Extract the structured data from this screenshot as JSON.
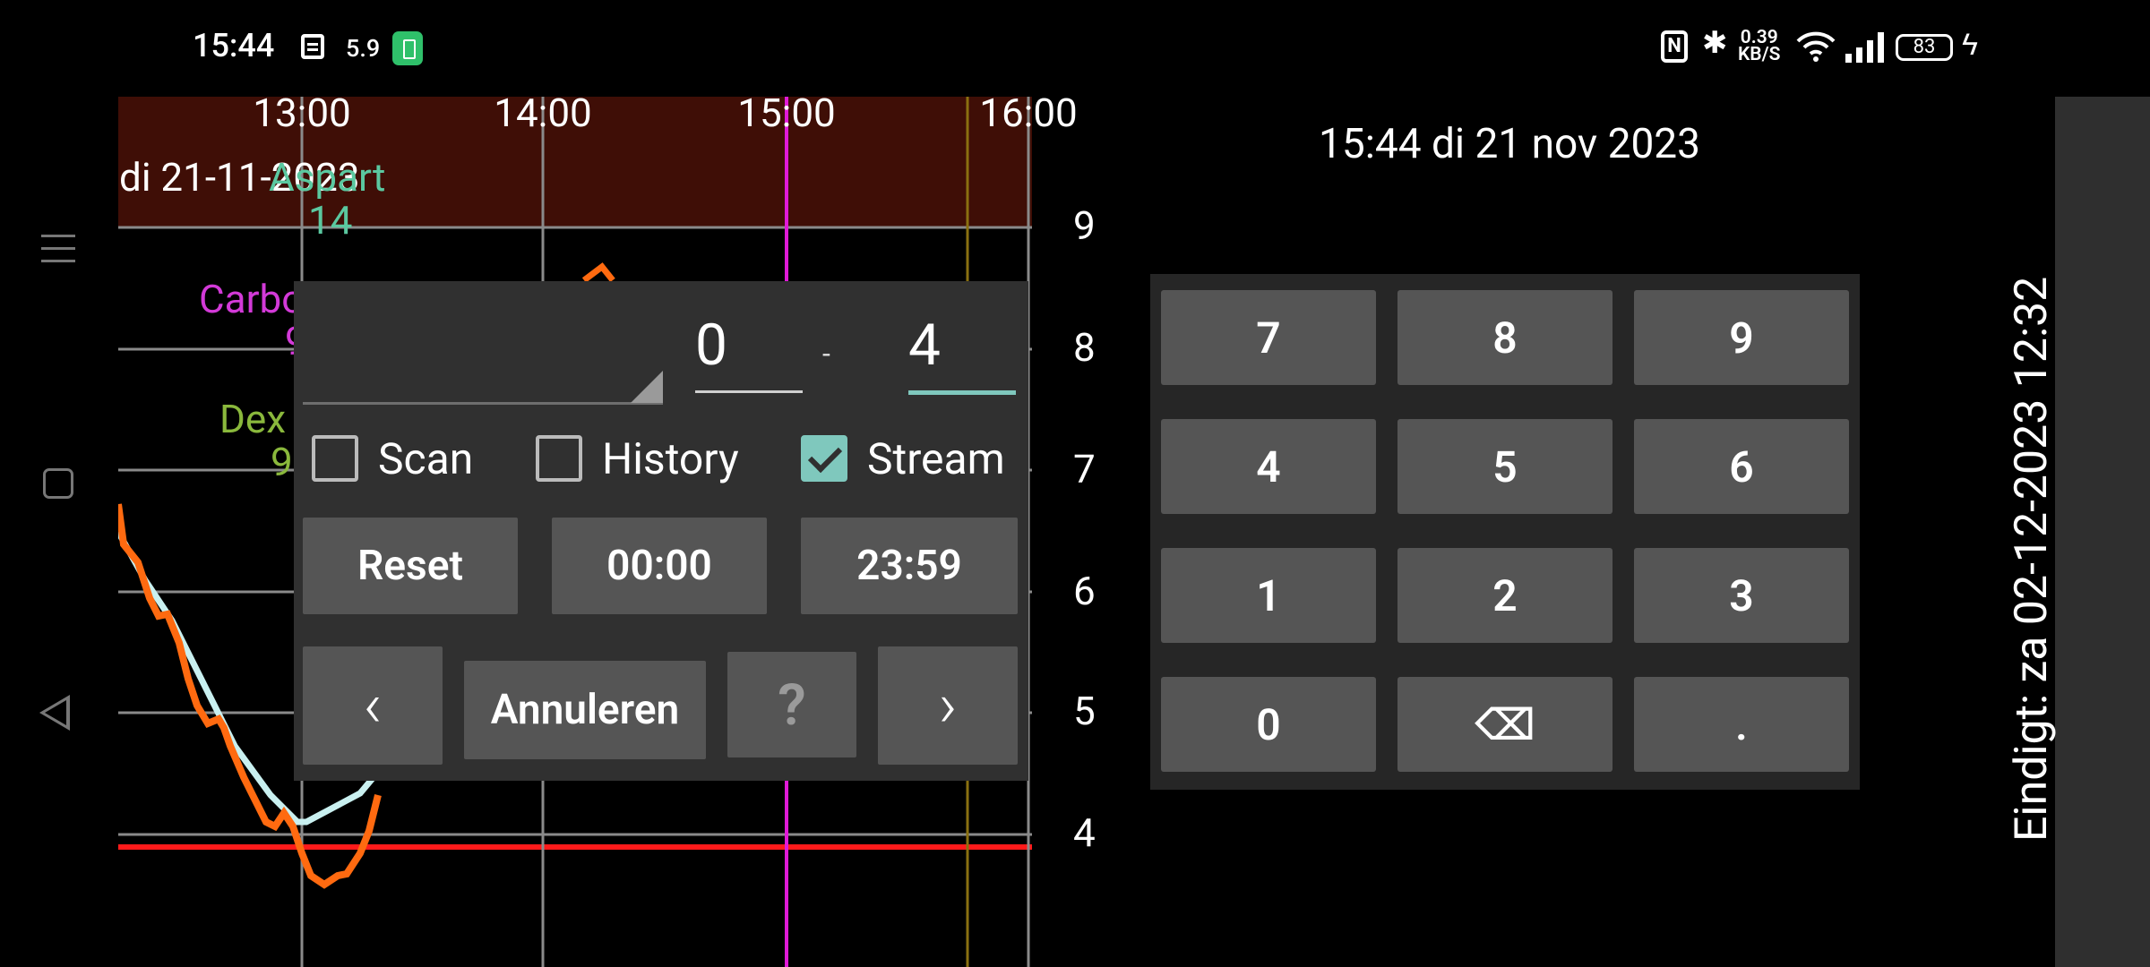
{
  "status_bar": {
    "time": "15:44",
    "notification_number": "5.9",
    "nfc": "N",
    "net_speed_value": "0.39",
    "net_speed_unit": "KB/S",
    "battery_level": "83"
  },
  "chart": {
    "date_label": "di 21-11-2023",
    "x_ticks": [
      "13:00",
      "14:00",
      "15:00",
      "16:00"
    ],
    "y_ticks": [
      "9",
      "8",
      "7",
      "6",
      "5",
      "4"
    ],
    "legend_aspart": "Aspart",
    "legend_aspart_value": "14",
    "legend_carbo": "Carbo",
    "legend_carbo_value": "9",
    "legend_dex": "Dex",
    "legend_dex_value": "9"
  },
  "dialog": {
    "range_from": "0",
    "range_separator": "-",
    "range_to": "4",
    "checkbox_scan": "Scan",
    "checkbox_history": "History",
    "checkbox_stream": "Stream",
    "reset_label": "Reset",
    "start_time": "00:00",
    "end_time": "23:59",
    "prev_label": "‹",
    "cancel_label": "Annuleren",
    "help_label": "?",
    "next_label": "›"
  },
  "header_date": "15:44 di 21 nov 2023",
  "keypad": {
    "keys": [
      "7",
      "8",
      "9",
      "4",
      "5",
      "6",
      "1",
      "2",
      "3",
      "0",
      "⌫",
      "."
    ]
  },
  "expires_label": "Eindigt: za 02-12-2023 12:32"
}
